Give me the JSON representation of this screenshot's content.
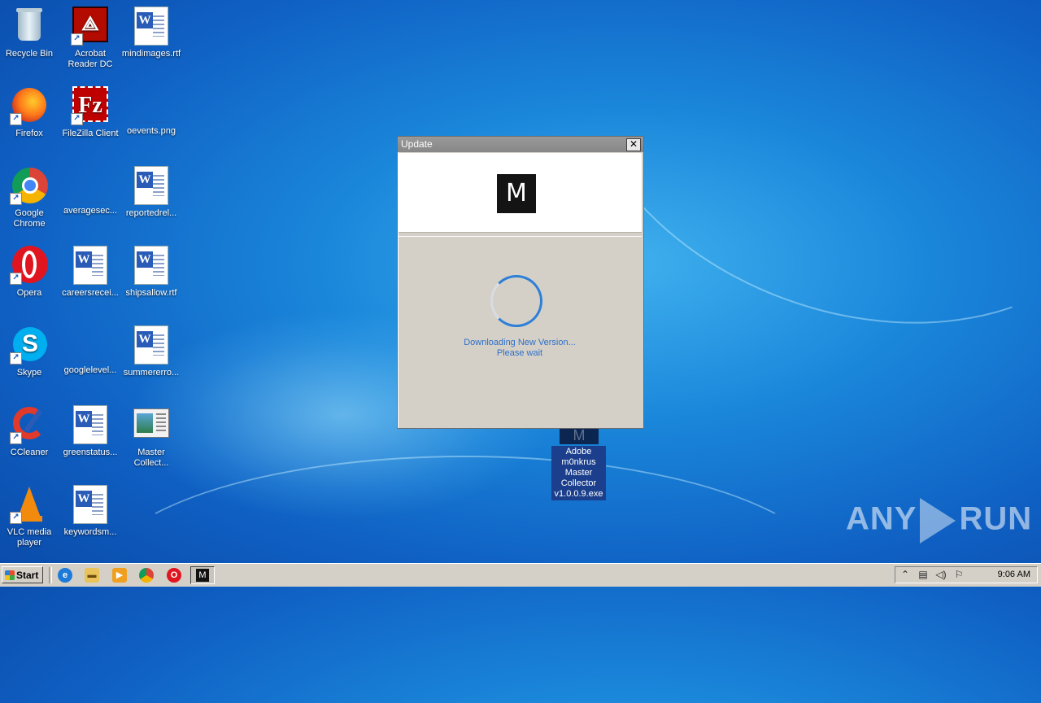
{
  "desktop": {
    "icons": [
      {
        "label": "Recycle Bin",
        "icon": "recycle-bin-icon"
      },
      {
        "label": "Acrobat Reader DC",
        "icon": "acrobat-icon"
      },
      {
        "label": "mindimages.rtf",
        "icon": "word-document-icon"
      },
      {
        "label": "Firefox",
        "icon": "firefox-icon"
      },
      {
        "label": "FileZilla Client",
        "icon": "filezilla-icon"
      },
      {
        "label": "oevents.png",
        "icon": "image-file-icon"
      },
      {
        "label": "Google Chrome",
        "icon": "chrome-icon"
      },
      {
        "label": "averagesec...",
        "icon": "blank-file-icon"
      },
      {
        "label": "reportedrel...",
        "icon": "word-document-icon"
      },
      {
        "label": "Opera",
        "icon": "opera-icon"
      },
      {
        "label": "careersrecei...",
        "icon": "word-document-icon"
      },
      {
        "label": "shipsallow.rtf",
        "icon": "word-document-icon"
      },
      {
        "label": "Skype",
        "icon": "skype-icon"
      },
      {
        "label": "googlelevel...",
        "icon": "blank-file-icon"
      },
      {
        "label": "summererro...",
        "icon": "word-document-icon"
      },
      {
        "label": "CCleaner",
        "icon": "ccleaner-icon"
      },
      {
        "label": "greenstatus...",
        "icon": "word-document-icon"
      },
      {
        "label": "Master Collect...",
        "icon": "window-file-icon"
      },
      {
        "label": "VLC media player",
        "icon": "vlc-icon"
      },
      {
        "label": "keywordsm...",
        "icon": "word-document-icon"
      }
    ],
    "selected_exe": {
      "glyph": "M",
      "label": "Adobe m0nkrus Master Collector v1.0.0.9.exe"
    }
  },
  "dialog": {
    "title": "Update",
    "close_glyph": "✕",
    "logo_letter": "M",
    "status_line1": "Downloading New Version...",
    "status_line2": "Please wait"
  },
  "watermark": {
    "left": "ANY",
    "right": "RUN"
  },
  "taskbar": {
    "start_label": "Start",
    "quick_launch": [
      "internet-explorer-icon",
      "explorer-folder-icon",
      "media-player-icon",
      "chrome-icon",
      "opera-icon"
    ],
    "active_task_glyph": "M",
    "tray_icons": [
      "tray-expand-icon",
      "network-icon",
      "volume-icon",
      "flag-icon"
    ],
    "clock": "9:06 AM"
  },
  "colors": {
    "accent": "#2d7fd8",
    "dialog_bg": "#d4d0c8",
    "titlebar": "#8a8a8a"
  }
}
